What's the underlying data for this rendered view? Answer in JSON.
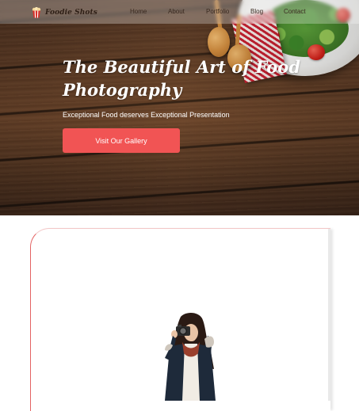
{
  "brand": {
    "name": "Foodie Shots",
    "icon": "popcorn-icon"
  },
  "nav": {
    "items": [
      "Home",
      "About",
      "Portfolio",
      "Blog",
      "Contact"
    ]
  },
  "hero": {
    "title": "The Beautiful Art of Food Photography",
    "subtitle": "Exceptional Food deserves Exceptional Presentation",
    "cta_label": "Visit Our Gallery"
  },
  "colors": {
    "accent": "#f15454",
    "text_light": "#ffffff",
    "nav_text": "#3a2a20"
  }
}
